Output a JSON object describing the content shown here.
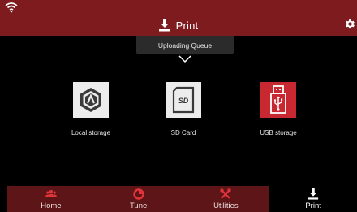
{
  "header": {
    "title": "Print",
    "title_icon": "download-tray-icon",
    "wifi_icon": "wifi-icon",
    "settings_icon": "gear-icon"
  },
  "queue": {
    "label": "Uploading Queue",
    "expand_icon": "chevron-down-icon"
  },
  "storage": [
    {
      "label": "Local storage",
      "icon": "local-storage-hex-icon"
    },
    {
      "label": "SD Card",
      "icon": "sd-card-icon"
    },
    {
      "label": "USB storage",
      "icon": "usb-icon"
    }
  ],
  "nav": [
    {
      "label": "Home",
      "icon": "users-icon"
    },
    {
      "label": "Tune",
      "icon": "tune-pie-icon"
    },
    {
      "label": "Utilities",
      "icon": "tools-icon"
    },
    {
      "label": "Print",
      "icon": "download-tray-icon",
      "active": true
    }
  ],
  "colors": {
    "header_bg": "#7e1b1e",
    "nav_bg": "#5e1518",
    "accent_red": "#e0343a",
    "usb_tile": "#c8282f"
  }
}
